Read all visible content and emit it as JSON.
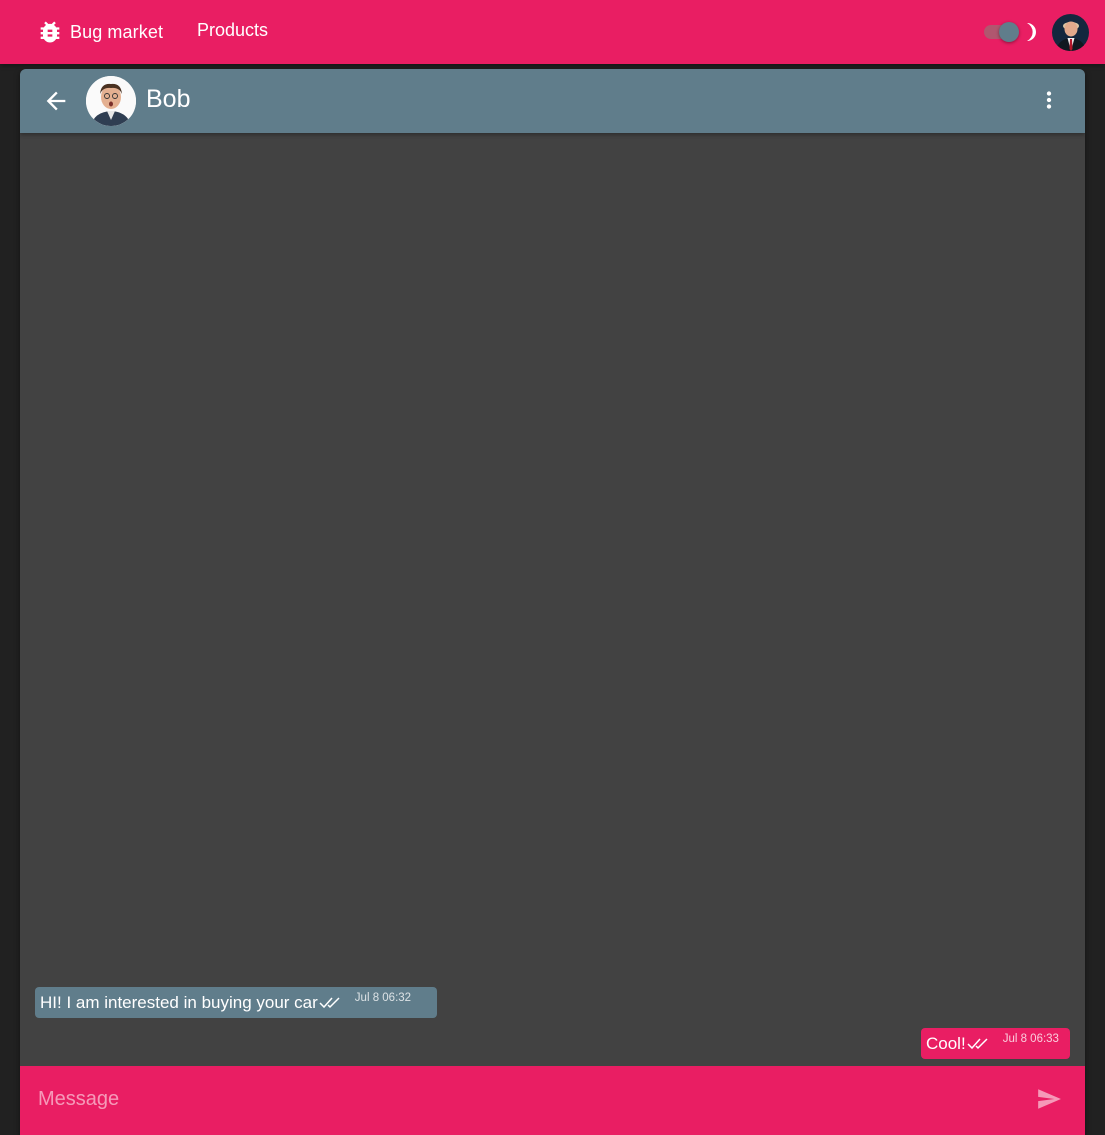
{
  "topbar": {
    "brand_label": "Bug market",
    "brand_icon": "bug-icon",
    "nav": [
      {
        "label": "Products"
      }
    ],
    "theme_toggle": {
      "on": true,
      "icon": "moon-icon"
    },
    "user_avatar": "avatar"
  },
  "chat": {
    "contact_name": "Bob",
    "header_icons": {
      "back": "arrow-back-icon",
      "more": "more-vert-icon"
    },
    "messages": [
      {
        "direction": "incoming",
        "text": "HI! I am interested in buying your car",
        "time": "Jul 8 06:32",
        "status_icon": "double-check-icon"
      },
      {
        "direction": "outgoing",
        "text": "Cool!",
        "time": "Jul 8 06:33",
        "status_icon": "double-check-icon"
      }
    ]
  },
  "composer": {
    "placeholder": "Message",
    "value": "",
    "send_icon": "send-icon"
  },
  "colors": {
    "primary": "#e91e63",
    "secondary": "#607d8b",
    "background": "#212121",
    "surface": "#424242"
  }
}
